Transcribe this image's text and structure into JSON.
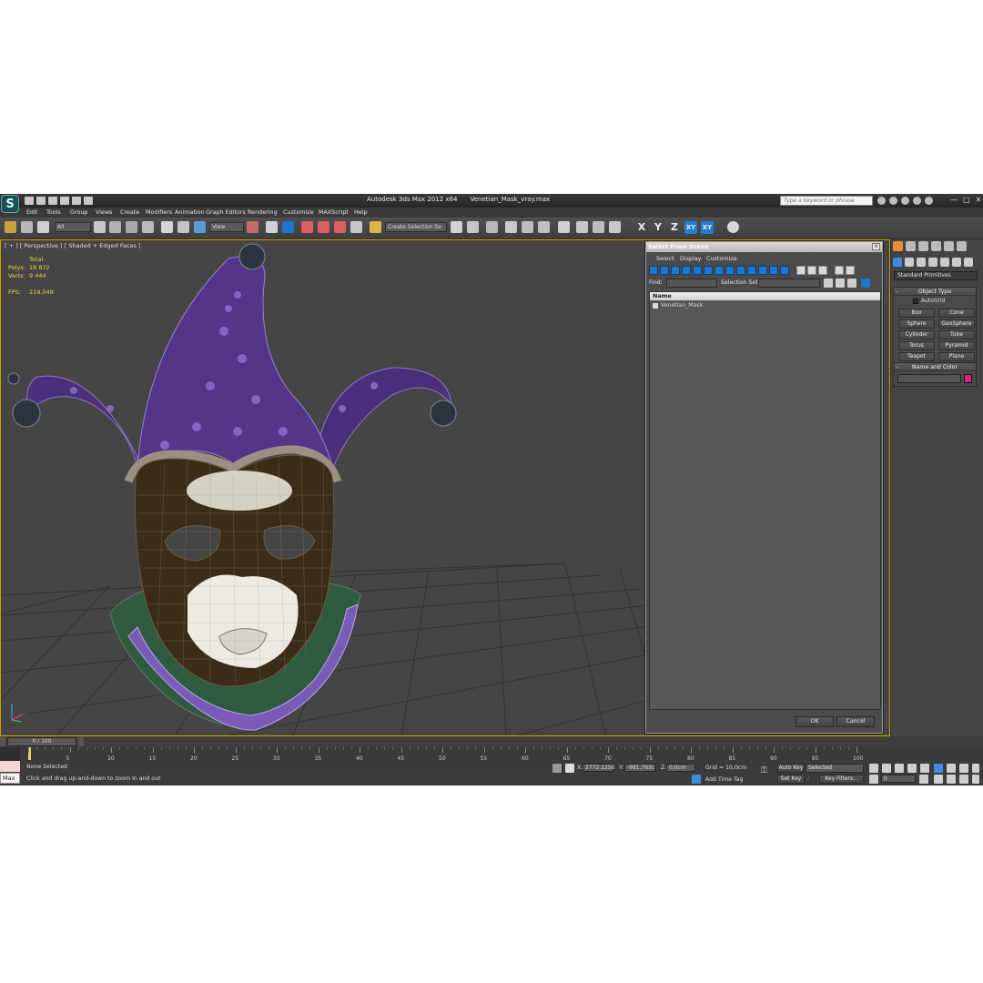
{
  "app": {
    "name": "Autodesk 3ds Max  2012 x64",
    "file": "Venetian_Mask_vray.max",
    "logo": "S",
    "search_placeholder": "Type a keyword or phrase"
  },
  "menu": [
    "Edit",
    "Tools",
    "Group",
    "Views",
    "Create",
    "Modifiers",
    "Animation",
    "Graph Editors",
    "Rendering",
    "Customize",
    "MAXScript",
    "Help"
  ],
  "toolbar": {
    "selection_filter": "All",
    "reference_coord": "View",
    "named_selection_placeholder": "Create Selection Se",
    "axis": [
      "X",
      "Y",
      "Z",
      "XY",
      "XY"
    ]
  },
  "viewport": {
    "label": "[ + ] [ Perspective ] [ Shaded + Edged Faces ]",
    "stats": {
      "header": "Total",
      "polys_label": "Polys:",
      "polys_value": "18 872",
      "verts_label": "Verts:",
      "verts_value": "9 444",
      "fps_label": "FPS:",
      "fps_value": "219,048"
    }
  },
  "select_dialog": {
    "title": "Select From Scene",
    "close": "x",
    "menu": [
      "Select",
      "Display",
      "Customize"
    ],
    "find_label": "Find:",
    "selection_set_label": "Selection Set:",
    "column_name": "Name",
    "items": [
      "Venetian_Mask"
    ],
    "ok": "OK",
    "cancel": "Cancel"
  },
  "command_panel": {
    "category": "Standard Primitives",
    "object_type_title": "Object Type",
    "autogrid": "AutoGrid",
    "primitives": [
      "Box",
      "Cone",
      "Sphere",
      "GeoSphere",
      "Cylinder",
      "Tube",
      "Torus",
      "Pyramid",
      "Teapot",
      "Plane"
    ],
    "name_color_title": "Name and Color",
    "color": "#e0207a"
  },
  "timeline": {
    "slider": "0 / 100",
    "ticks": [
      "0",
      "5",
      "10",
      "15",
      "20",
      "25",
      "30",
      "35",
      "40",
      "45",
      "50",
      "55",
      "60",
      "65",
      "70",
      "75",
      "80",
      "85",
      "90",
      "95",
      "100"
    ]
  },
  "status": {
    "maxscript_label": "Max",
    "selection": "None Selected",
    "prompt": "Click and drag up-and-down to zoom in and out",
    "x_label": "X:",
    "x_value": "2772,1256",
    "y_label": "Y:",
    "y_value": "-981,763c",
    "z_label": "Z:",
    "z_value": "0,0cm",
    "grid": "Grid = 10,0cm",
    "add_time_tag": "Add Time Tag",
    "auto_key": "Auto Key",
    "set_key": "Set Key",
    "key_mode": "Selected",
    "key_filters": "Key Filters...",
    "frame": "0"
  }
}
